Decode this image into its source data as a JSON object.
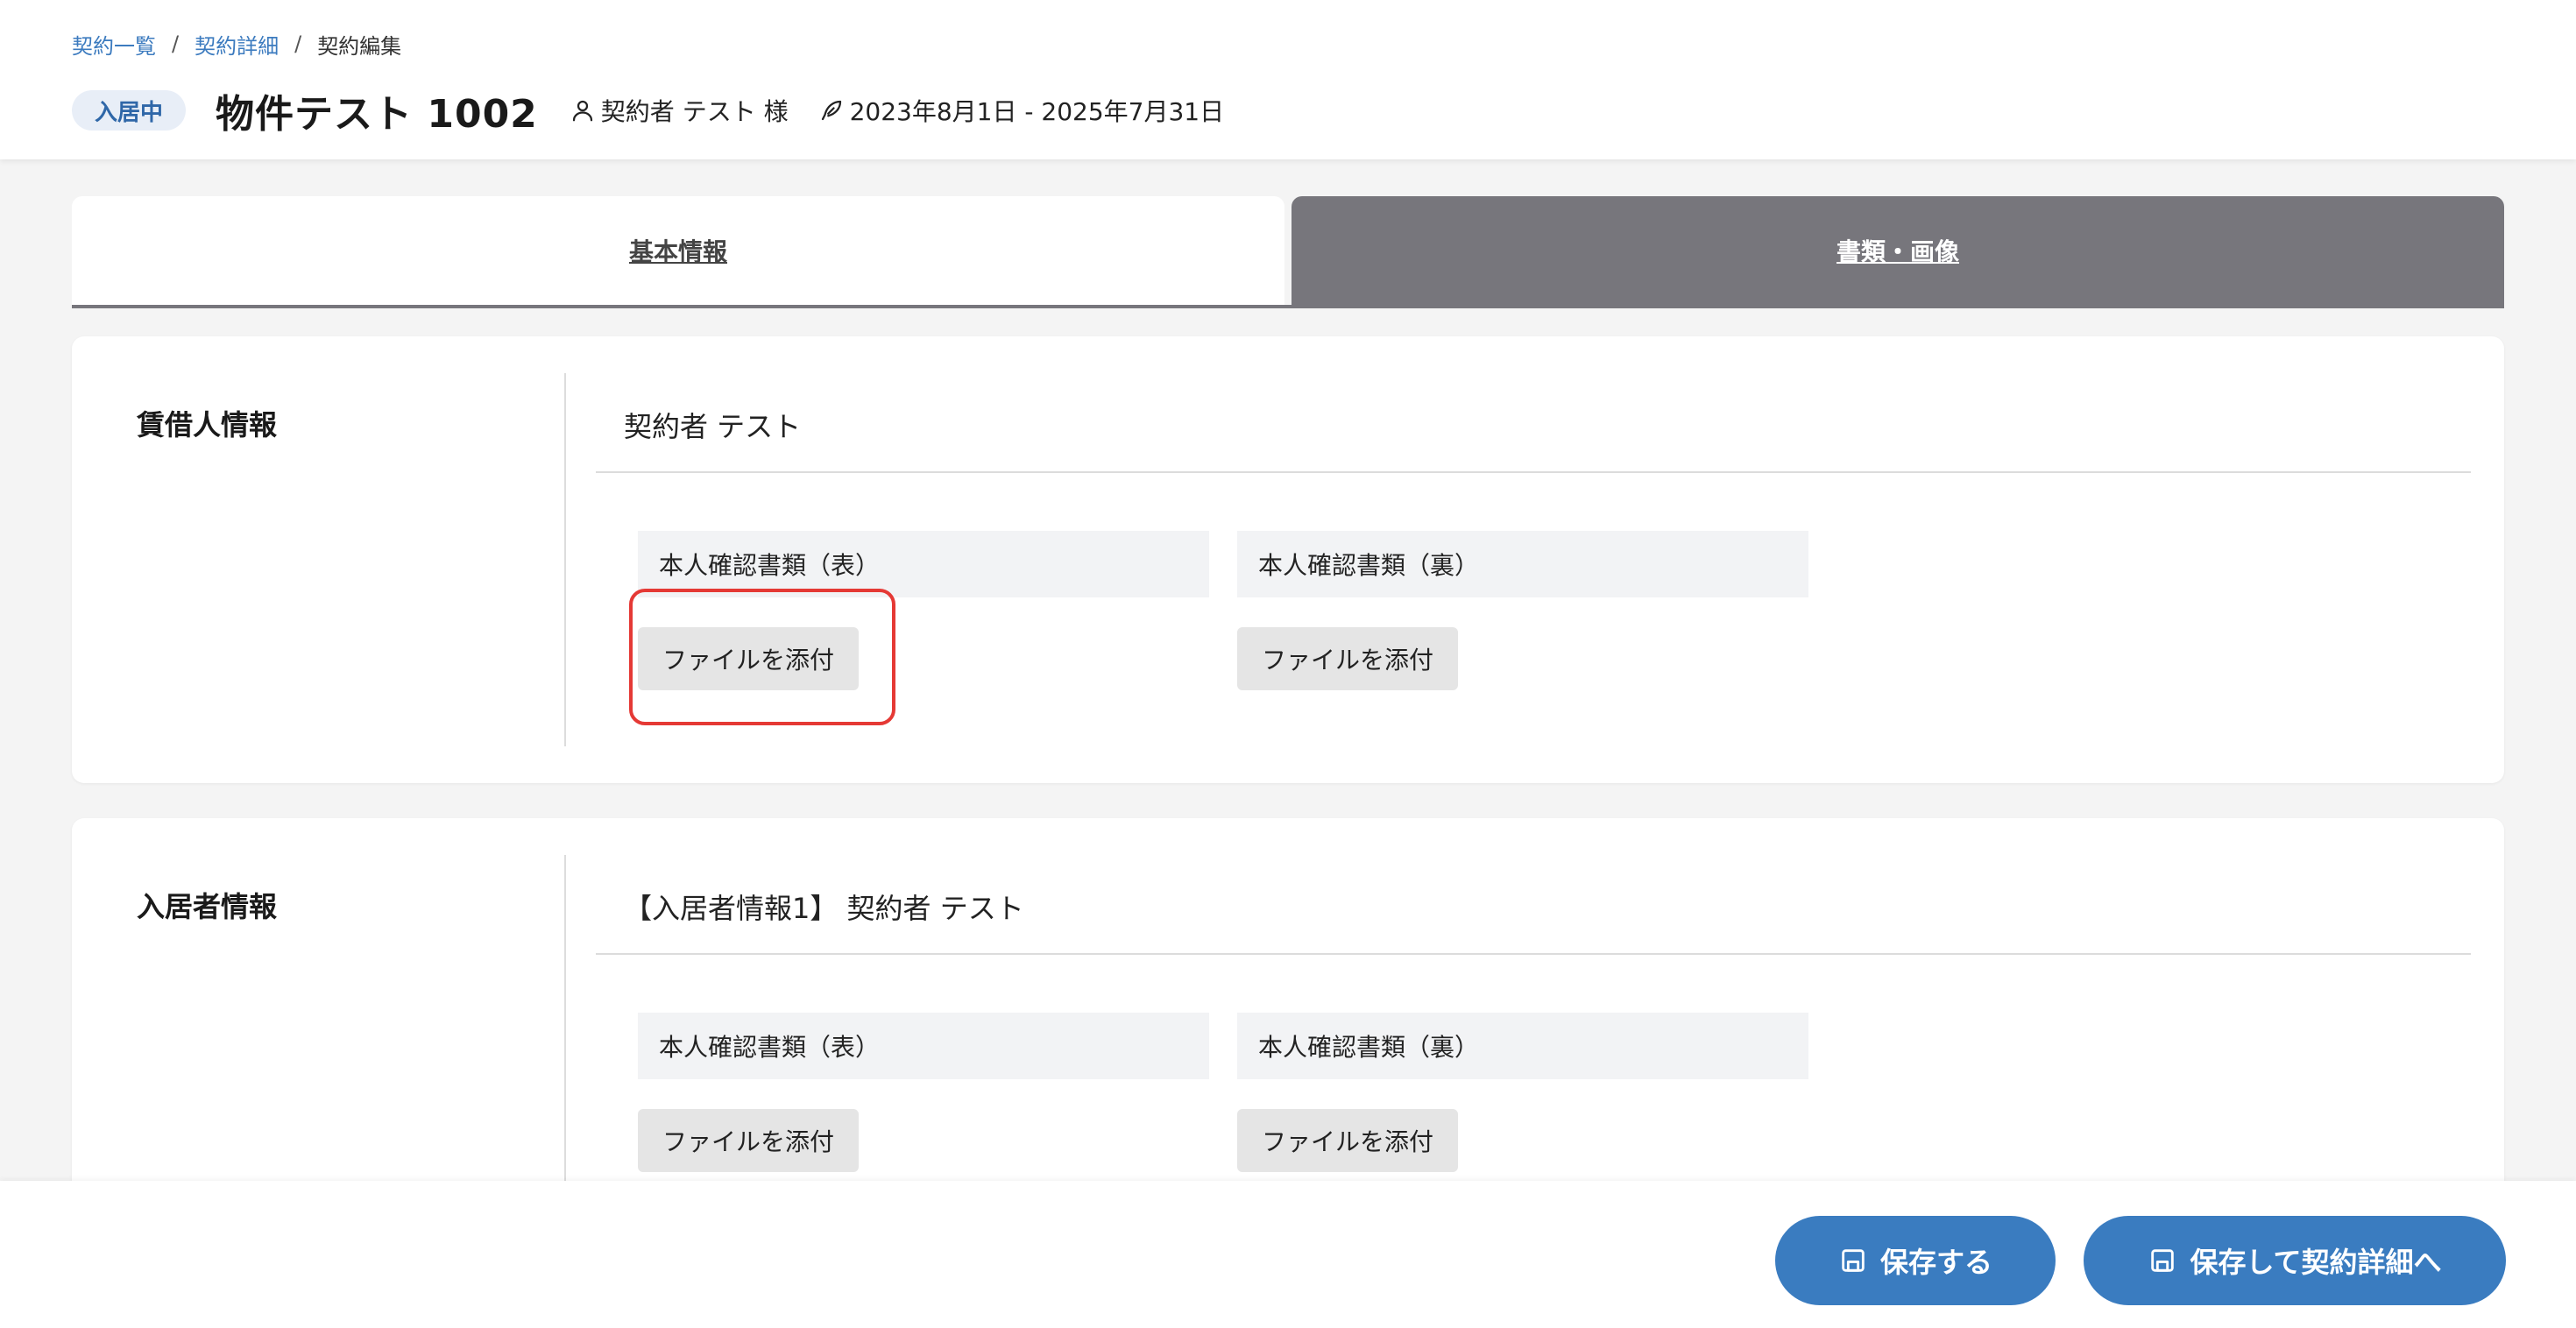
{
  "breadcrumb": {
    "items": [
      "契約一覧",
      "契約詳細"
    ],
    "current": "契約編集",
    "separator": "/"
  },
  "header": {
    "status": "入居中",
    "title": "物件テスト 1002",
    "contractor": "契約者 テスト 様",
    "period": "2023年8月1日 - 2025年7月31日"
  },
  "tabs": [
    {
      "label": "基本情報",
      "active": false
    },
    {
      "label": "書類・画像",
      "active": true
    }
  ],
  "sections": {
    "tenant": {
      "label": "賃借人情報",
      "name": "契約者 テスト",
      "docs": [
        {
          "label": "本人確認書類（表）",
          "button": "ファイルを添付"
        },
        {
          "label": "本人確認書類（裏）",
          "button": "ファイルを添付"
        }
      ]
    },
    "resident": {
      "label": "入居者情報",
      "name": "【入居者情報1】 契約者 テスト",
      "docs": [
        {
          "label": "本人確認書類（表）",
          "button": "ファイルを添付"
        },
        {
          "label": "本人確認書類（裏）",
          "button": "ファイルを添付"
        }
      ]
    }
  },
  "footer": {
    "save_label": "保存する",
    "save_detail_label": "保存して契約詳細へ"
  },
  "colors": {
    "primary": "#3a7cc0",
    "link": "#3c7bbf",
    "tab_active": "#77767c",
    "highlight": "#e53935"
  },
  "icons": {
    "contractor": "person-icon",
    "period": "pen-icon",
    "save": "floppy-disk-icon"
  }
}
